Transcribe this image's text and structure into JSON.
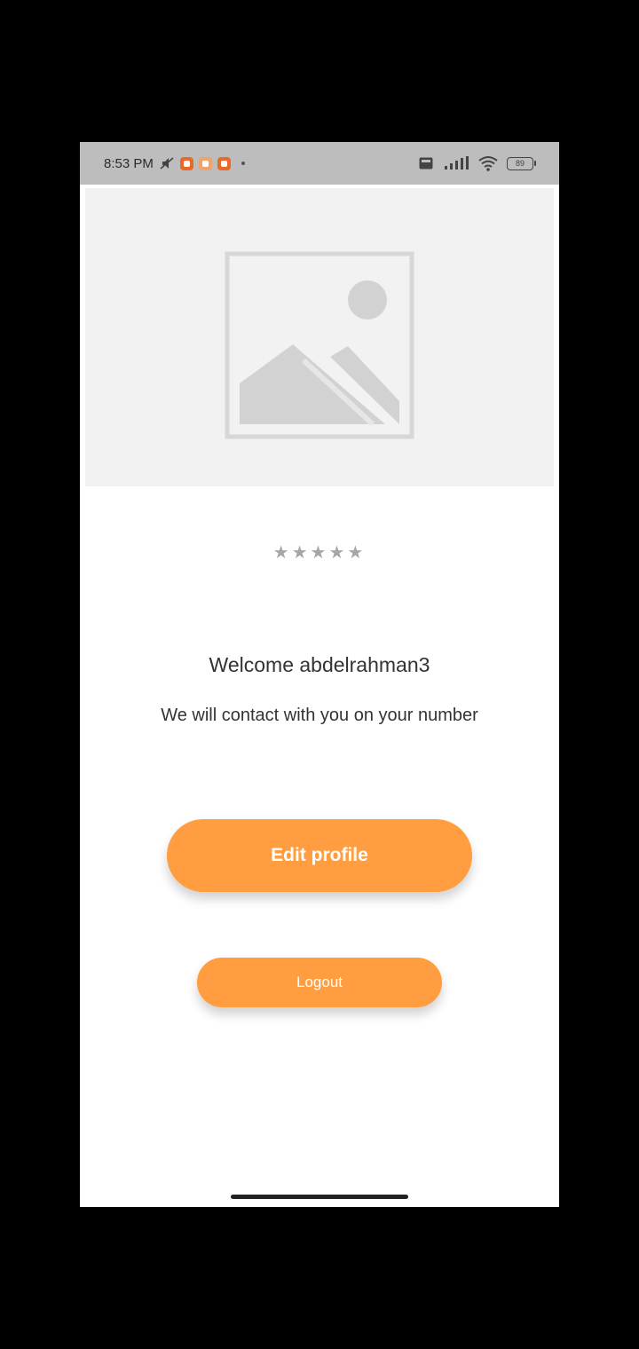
{
  "status_bar": {
    "time": "8:53 PM",
    "icons": [
      "mute-icon",
      "app-notification-icon",
      "app-notification-icon",
      "app-notification-icon",
      "more-dot-icon",
      "volte-icon",
      "signal-icon",
      "wifi-icon",
      "battery-icon"
    ],
    "battery_level": "89"
  },
  "profile": {
    "image_alt": "profile-image-placeholder",
    "rating_stars": "★★★★★",
    "rating_value": 0,
    "rating_max": 5,
    "welcome_text": "Welcome abdelrahman3",
    "message_text": "We will contact with you on your number"
  },
  "actions": {
    "edit_profile_label": "Edit profile",
    "logout_label": "Logout"
  },
  "colors": {
    "accent": "#ff9d40",
    "status_bar_bg": "#bdbdbd",
    "placeholder_bg": "#f2f2f2",
    "star_empty": "#a6a6a6"
  }
}
